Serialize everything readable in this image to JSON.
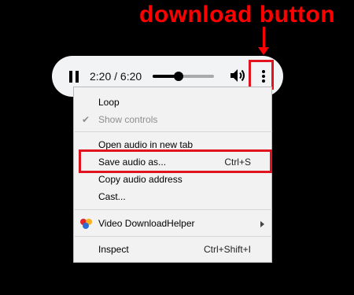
{
  "annotation": {
    "label": "download button",
    "color": "#ff0000"
  },
  "player": {
    "pause_icon": "pause-icon",
    "time": "2:20 / 6:20",
    "volume_level": 0.42,
    "volume_icon": "speaker-icon",
    "more_icon": "vertical-dots-icon"
  },
  "menu": {
    "items": [
      {
        "label": "Loop",
        "shortcut": ""
      },
      {
        "label": "Show controls",
        "shortcut": "",
        "checked": true,
        "disabled": true
      },
      {
        "label": "Open audio in new tab",
        "shortcut": ""
      },
      {
        "label": "Save audio as...",
        "shortcut": "Ctrl+S"
      },
      {
        "label": "Copy audio address",
        "shortcut": ""
      },
      {
        "label": "Cast...",
        "shortcut": ""
      },
      {
        "label": "Video DownloadHelper",
        "shortcut": "",
        "icon": "video-downloadhelper-icon",
        "submenu": true
      },
      {
        "label": "Inspect",
        "shortcut": "Ctrl+Shift+I"
      }
    ]
  },
  "colors": {
    "highlight": "#e0141e",
    "menu_background": "#f2f2f2",
    "player_background": "#f1f3f4"
  }
}
